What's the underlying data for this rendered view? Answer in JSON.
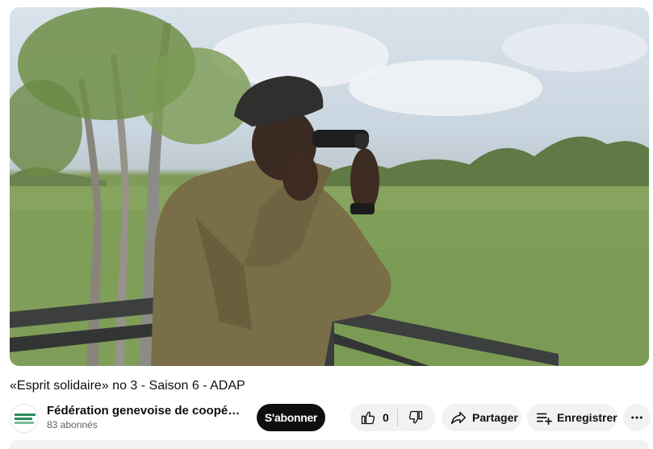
{
  "video": {
    "thumbnail_icon": "video-frame-man-with-binoculars",
    "title": "«Esprit solidaire» no 3 - Saison 6 - ADAP"
  },
  "channel": {
    "avatar_icon": "federation-logo-icon",
    "name": "Fédération genevoise de coopérati…",
    "subscribers": "83 abonnés"
  },
  "actions": {
    "subscribe_label": "S'abonner",
    "like_count": "0",
    "like_icon": "thumbs-up-icon",
    "dislike_icon": "thumbs-down-icon",
    "share_label": "Partager",
    "share_icon": "share-arrow-icon",
    "save_label": "Enregistrer",
    "save_icon": "playlist-add-icon",
    "more_icon": "more-horizontal-icon"
  },
  "colors": {
    "subscribe_bg": "#0f0f0f",
    "pill_bg": "#f2f2f2",
    "secondary_text": "#606060"
  }
}
